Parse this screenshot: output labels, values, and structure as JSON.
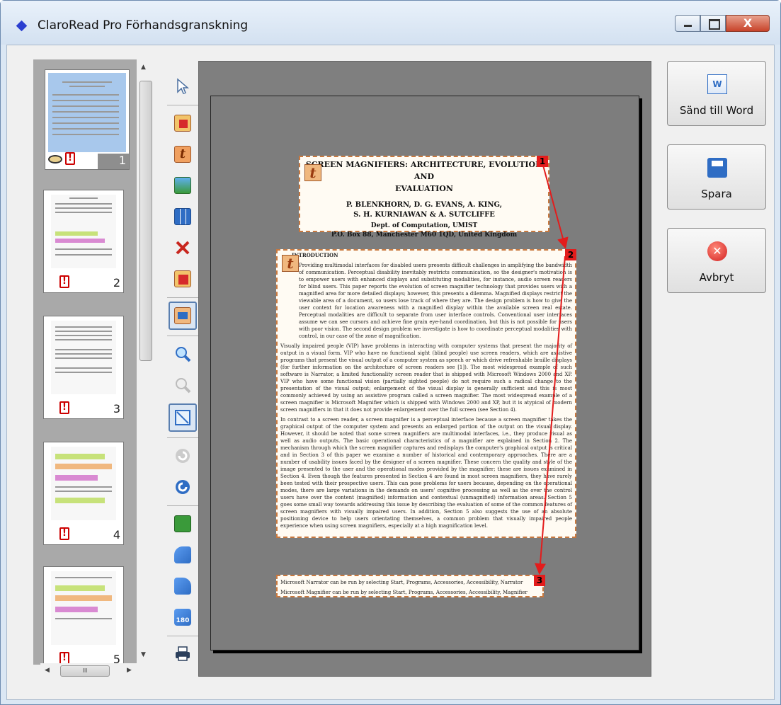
{
  "window": {
    "title": "ClaroRead Pro Förhandsgranskning"
  },
  "thumbnails": [
    {
      "number": "1",
      "selected": true
    },
    {
      "number": "2",
      "selected": false
    },
    {
      "number": "3",
      "selected": false
    },
    {
      "number": "4",
      "selected": false
    },
    {
      "number": "5",
      "selected": false
    }
  ],
  "toolbar": {
    "items": [
      "pointer-icon",
      "delete-block-icon",
      "text-block-icon",
      "image-block-icon",
      "table-block-icon",
      "delete-icon",
      "delete-all-icon",
      "reorder-icon",
      "zoom-in-icon",
      "zoom-out-icon",
      "fit-page-icon",
      "undo-icon",
      "redo-icon",
      "rotate-icon",
      "rotate-left-icon",
      "rotate-right-icon",
      "rotate-180-icon",
      "print-icon"
    ]
  },
  "document": {
    "title_block": {
      "line1": "SCREEN MAGNIFIERS: ARCHITECTURE, EVOLUTION AND",
      "line2": "EVALUATION",
      "authors1": "P. BLENKHORN, D. G. EVANS, A. KING,",
      "authors2": "S. H. KURNIAWAN & A. SUTCLIFFE",
      "dept": "Dept. of Computation, UMIST",
      "address": "P.O. Box 88, Manchester M60 1QD, United Kingdom"
    },
    "body_block": {
      "heading": "INTRODUCTION",
      "p1": "Providing multimodal interfaces for disabled users presents difficult challenges in amplifying the bandwidth of communication. Perceptual disability inevitably restricts communication, so the designer's motivation is to empower users with enhanced displays and substituting modalities, for instance, audio screen readers for blind users. This paper reports the evolution of screen magnifier technology that provides users with a magnified area for more detailed displays; however, this presents a dilemma. Magnified displays restrict the viewable area of a document, so users lose track of where they are. The design problem is how to give the user context for location awareness with a magnified display within the available screen real estate. Perceptual modalities are difficult to separate from user interface controls. Conventional user interfaces assume we can see cursors and achieve fine grain eye-hand coordination, but this is not possible for users with poor vision. The second design problem we investigate is how to coordinate perceptual modalities with control, in our case of the zone of magnification.",
      "p2": "Visually impaired people (VIP) have problems in interacting with computer systems that present the majority of output in a visual form. VIP who have no functional sight (blind people) use screen readers, which are assistive programs that present the visual output of a computer system as speech or which drive refreshable braille displays (for further information on the architecture of screen readers see [1]). The most widespread example of such software is Narrator, a limited functionality screen reader that is shipped with Microsoft Windows 2000 and XP. VIP who have some functional vision (partially sighted people) do not require such a radical change to the presentation of the visual output; enlargement of the visual display is generally sufficient and this is most commonly achieved by using an assistive program called a screen magnifier. The most widespread example of a screen magnifier is Microsoft Magnifier which is shipped with Windows 2000 and XP, but it is atypical of modern screen magnifiers in that it does not provide enlargement over the full screen (see Section 4).",
      "p3": "In contrast to a screen reader, a screen magnifier is a perceptual interface because a screen magnifier takes the graphical output of the computer system and presents an enlarged portion of the output on the visual display. However, it should be noted that some screen magnifiers are multimodal interfaces, i.e., they produce visual as well as audio outputs. The basic operational characteristics of a magnifier are explained in Section 2. The mechanism through which the screen magnifier captures and redisplays the computer's graphical output is critical and in Section 3 of this paper we examine a number of historical and contemporary approaches. There are a number of usability issues faced by the designer of a screen magnifier. These concern the quality and style of the image presented to the user and the operational modes provided by the magnifier; these are issues examined in Section 4. Even though the features presented in Section 4 are found in most screen magnifiers, they have rarely been tested with their prospective users. This can pose problems for users because, depending on the operational modes, there are large variations in the demands on users' cognitive processing as well as the over the control users have over the content (magnified) information and contextual (unmagnified) information areas. Section 5 goes some small way towards addressing this issue by describing the evaluation of some of the common features of screen magnifiers with visually impaired users. In addition, Section 5 also suggests the use of an absolute positioning device to help users orientating themselves, a common problem that visually impaired people experience when using screen magnifiers, especially at a high magnification level."
    },
    "footnote_block": {
      "line1": "Microsoft Narrator can be run by selecting Start, Programs, Accessories, Accessibility, Narrator",
      "line2": "Microsoft Magnifier can be run by selecting Start, Programs, Accessories, Accessibility, Magnifier"
    },
    "order_badges": [
      "1",
      "2",
      "3"
    ]
  },
  "actions": {
    "send_to_word": "Sänd till Word",
    "save": "Spara",
    "cancel": "Avbryt"
  },
  "colors": {
    "accent": "#c8783e",
    "badge": "#e31c1c",
    "order_arrow": "#e31c1c"
  }
}
